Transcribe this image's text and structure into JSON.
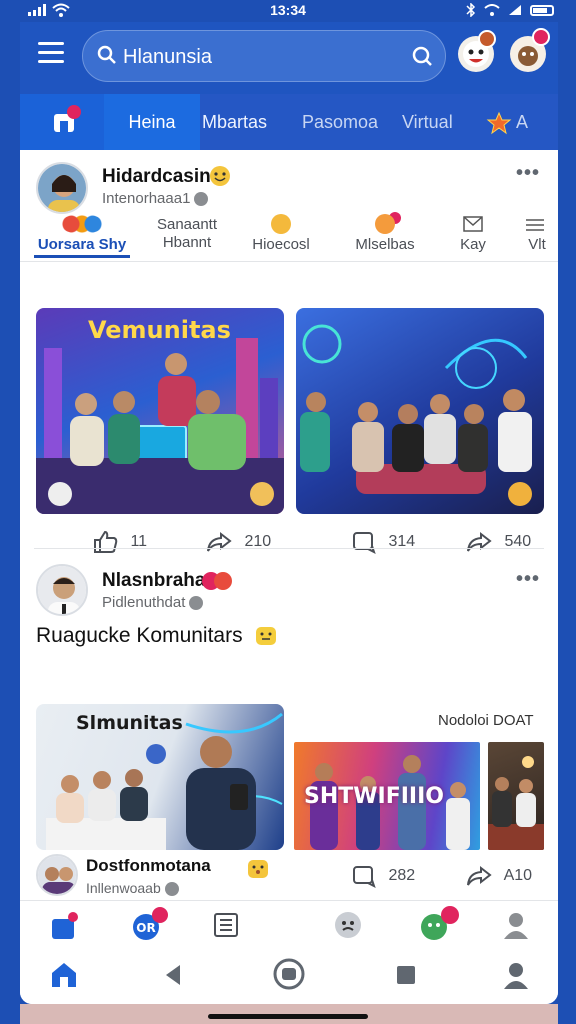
{
  "status": {
    "time": "13:34"
  },
  "search": {
    "value": "Hlanunsia"
  },
  "top_badges": {
    "b1": "",
    "b2": ""
  },
  "tabs": [
    {
      "label": "Heina"
    },
    {
      "label": "Mbartas"
    },
    {
      "label": "Pasomoa"
    },
    {
      "label": "Virtual"
    },
    {
      "label": "A"
    }
  ],
  "post1": {
    "author": "Hidardcasin",
    "subtitle": "Intenorhaaa1",
    "reactions": [
      {
        "label": "Uorsara Shy"
      },
      {
        "label": "Sanaantt Hbannt"
      },
      {
        "label": "Hioecosl"
      },
      {
        "label": "Mlselbas"
      },
      {
        "label": "Kay"
      },
      {
        "label": "Vlt"
      }
    ],
    "image1_title": "Vemunitas",
    "likes": "11",
    "shares": "210",
    "comments": "314",
    "forwards": "540"
  },
  "post2": {
    "author": "Nlasnbraha",
    "subtitle": "Pidlenuthdat",
    "text": "Ruagucke Komunitars",
    "image1_title": "Slmunitas",
    "image2_caption": "Nodoloi DOAT",
    "image2_title": "SHTWIFIIIO",
    "sub_author": "Dostfonmotana",
    "sub_subtitle": "Inllenwoaab",
    "comments": "282",
    "forwards": "A10"
  }
}
